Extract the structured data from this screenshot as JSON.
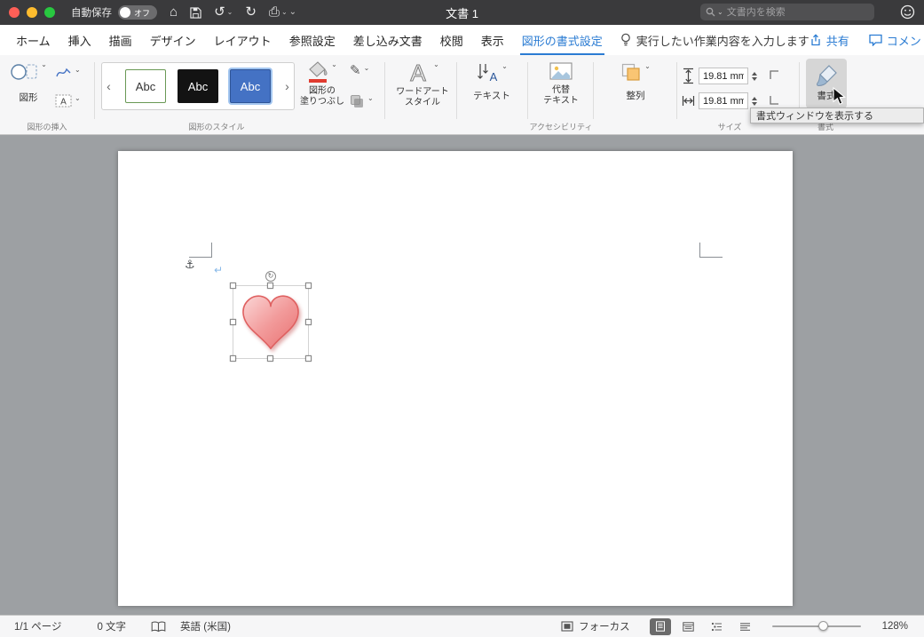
{
  "titlebar": {
    "autosave_label": "自動保存",
    "autosave_state": "オフ",
    "doc_title": "文書 1",
    "search_placeholder": "文書内を検索"
  },
  "menubar": {
    "tabs": [
      {
        "label": "ホーム"
      },
      {
        "label": "挿入"
      },
      {
        "label": "描画"
      },
      {
        "label": "デザイン"
      },
      {
        "label": "レイアウト"
      },
      {
        "label": "参照設定"
      },
      {
        "label": "差し込み文書"
      },
      {
        "label": "校閲"
      },
      {
        "label": "表示"
      },
      {
        "label": "図形の書式設定"
      }
    ],
    "active_tab": "図形の書式設定",
    "tell_me": "実行したい作業内容を入力します",
    "share_label": "共有",
    "comments_label": "コメント"
  },
  "ribbon": {
    "shapes": {
      "button_label": "図形",
      "group_label": "図形の挿入"
    },
    "styles": {
      "gallery": [
        {
          "label": "Abc"
        },
        {
          "label": "Abc"
        },
        {
          "label": "Abc"
        }
      ],
      "fill_label": "図形の\n塗りつぶし",
      "group_label": "図形のスタイル"
    },
    "wordart": {
      "label": "ワードアート\nスタイル"
    },
    "text": {
      "label": "テキスト"
    },
    "accessibility": {
      "alt_text_label": "代替\nテキスト",
      "group_label": "アクセシビリティ"
    },
    "arrange": {
      "label": "整列"
    },
    "size": {
      "height_value": "19.81 mm",
      "width_value": "19.81 mm",
      "group_label": "サイズ"
    },
    "format": {
      "button_label": "書式",
      "group_label": "書式"
    },
    "tooltip": "書式ウィンドウを表示する"
  },
  "statusbar": {
    "page_info": "1/1 ページ",
    "word_count": "0 文字",
    "language": "英語 (米国)",
    "focus_label": "フォーカス",
    "zoom_level": "128%"
  },
  "icons": {
    "home": "⌂",
    "undo": "↺",
    "redo": "↻",
    "print": "⎙",
    "chevron_down": "⌄",
    "gallery_prev": "‹",
    "gallery_next": "›",
    "pencil": "✎",
    "anchor": "⚓",
    "return_mark": "↵",
    "rotate": "↻"
  },
  "colors": {
    "accent_blue": "#2b7cd3",
    "titlebar_bg": "#3a3a3c",
    "heart_fill_light": "#f9c6c6",
    "heart_fill_dark": "#ea7878",
    "heart_outline": "#e06060",
    "fill_swatch_red": "#e03b30",
    "arrange_swatch_orange": "#f9c573",
    "gallery_blue": "#4472c4"
  }
}
